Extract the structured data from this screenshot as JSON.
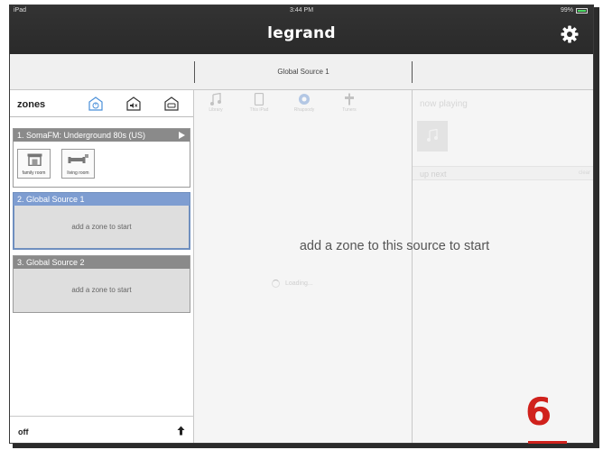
{
  "status_bar": {
    "device": "iPad",
    "time": "3:44 PM",
    "battery": "99%"
  },
  "header": {
    "brand": "legrand",
    "settings_icon": "gear-icon"
  },
  "source_bar": {
    "active_source": "Global Source 1"
  },
  "zones_panel": {
    "title": "zones",
    "header_icons": [
      "power-icon",
      "mute-icon",
      "home-icon"
    ],
    "sources": [
      {
        "title": "1. SomaFM: Underground 80s (US)",
        "playing": true,
        "zones": [
          {
            "label": "family room",
            "icon": "fireplace-icon"
          },
          {
            "label": "living room",
            "icon": "sofa-icon"
          }
        ]
      },
      {
        "title": "2. Global Source 1",
        "selected": true,
        "empty_text": "add a zone to start"
      },
      {
        "title": "3. Global Source 2",
        "selected": false,
        "empty_text": "add a zone to start"
      }
    ],
    "footer": {
      "off_label": "off",
      "arrow_icon": "up-arrow-icon"
    }
  },
  "browse_panel": {
    "tabs": [
      {
        "label": "Library",
        "icon": "music-note-icon"
      },
      {
        "label": "This iPad",
        "icon": "ipad-icon"
      },
      {
        "label": "Rhapsody",
        "icon": "rhapsody-icon"
      },
      {
        "label": "Tuners",
        "icon": "tuner-icon"
      }
    ],
    "loading_text": "Loading..."
  },
  "queue_panel": {
    "now_playing": "now playing",
    "up_next": "up next",
    "clear": "clear"
  },
  "overlay_message": "add a zone to this source to start",
  "page_number": "6",
  "colors": {
    "accent_red": "#d0211c",
    "selected_blue": "#7e9dd1",
    "header_dark": "#2e2e2e"
  }
}
